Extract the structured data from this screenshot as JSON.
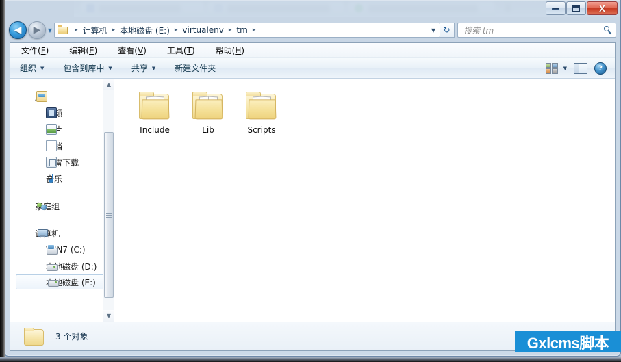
{
  "window": {
    "controls": {
      "minimize": "—",
      "maximize": "□",
      "close": "X"
    }
  },
  "address_bar": {
    "back_label": "◀",
    "forward_label": "▶",
    "history_caret": "▼",
    "folder_icon": "folder-icon",
    "breadcrumb": [
      "计算机",
      "本地磁盘 (E:)",
      "virtualenv",
      "tm"
    ],
    "breadcrumb_separator": "▸",
    "dropdown_caret": "▼",
    "refresh_label": "↻",
    "search_placeholder": "搜索 tm"
  },
  "menubar": {
    "items": [
      {
        "text": "文件(F)",
        "label": "文件",
        "accel": "F"
      },
      {
        "text": "编辑(E)",
        "label": "编辑",
        "accel": "E"
      },
      {
        "text": "查看(V)",
        "label": "查看",
        "accel": "V"
      },
      {
        "text": "工具(T)",
        "label": "工具",
        "accel": "T"
      },
      {
        "text": "帮助(H)",
        "label": "帮助",
        "accel": "H"
      }
    ]
  },
  "command_bar": {
    "items": [
      {
        "label": "组织",
        "caret": "▼"
      },
      {
        "label": "包含到库中",
        "caret": "▼"
      },
      {
        "label": "共享",
        "caret": "▼"
      },
      {
        "label": "新建文件夹",
        "caret": ""
      }
    ],
    "view_caret": "▼",
    "help_glyph": "?"
  },
  "navigation_pane": {
    "groups": [
      {
        "root": {
          "label": "库",
          "icon": "library-icon"
        },
        "children": [
          {
            "label": "视频",
            "icon": "video-icon"
          },
          {
            "label": "图片",
            "icon": "pictures-icon"
          },
          {
            "label": "文档",
            "icon": "documents-icon"
          },
          {
            "label": "迅雷下载",
            "icon": "downloads-icon"
          },
          {
            "label": "音乐",
            "icon": "music-icon"
          }
        ]
      },
      {
        "root": {
          "label": "家庭组",
          "icon": "homegroup-icon"
        },
        "children": []
      },
      {
        "root": {
          "label": "计算机",
          "icon": "computer-icon"
        },
        "children": [
          {
            "label": "WIN7 (C:)",
            "icon": "system-drive-icon",
            "selected": false
          },
          {
            "label": "本地磁盘 (D:)",
            "icon": "drive-icon",
            "selected": false
          },
          {
            "label": "本地磁盘 (E:)",
            "icon": "drive-icon",
            "selected": true
          }
        ]
      }
    ],
    "scrollbar": {
      "up": "▲",
      "down": "▼"
    }
  },
  "file_list": {
    "items": [
      {
        "name": "Include",
        "type": "folder"
      },
      {
        "name": "Lib",
        "type": "folder"
      },
      {
        "name": "Scripts",
        "type": "folder"
      }
    ]
  },
  "status_bar": {
    "count_text": "3 个对象",
    "icon": "folder-icon"
  },
  "watermark": {
    "text": "Gxlcms脚本",
    "background_color": "#1a8fd6",
    "text_color": "#ffffff"
  }
}
